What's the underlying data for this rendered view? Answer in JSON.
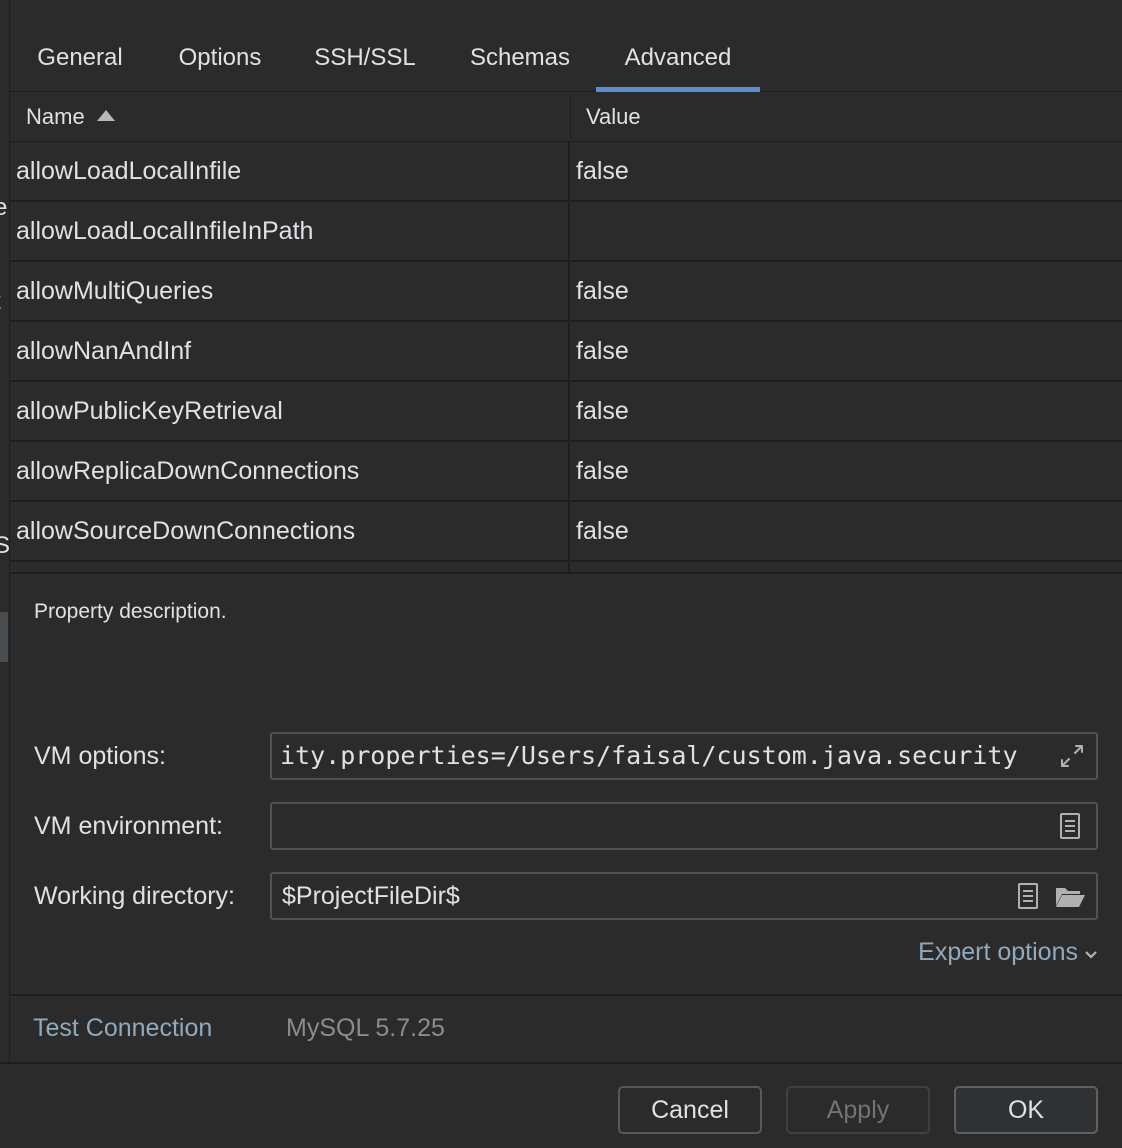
{
  "tabs": [
    {
      "label": "General"
    },
    {
      "label": "Options"
    },
    {
      "label": "SSH/SSL"
    },
    {
      "label": "Schemas"
    },
    {
      "label": "Advanced",
      "active": true
    }
  ],
  "table": {
    "headers": {
      "name": "Name",
      "value": "Value"
    },
    "rows": [
      {
        "name": "allowLoadLocalInfile",
        "value": "false"
      },
      {
        "name": "allowLoadLocalInfileInPath",
        "value": ""
      },
      {
        "name": "allowMultiQueries",
        "value": "false"
      },
      {
        "name": "allowNanAndInf",
        "value": "false"
      },
      {
        "name": "allowPublicKeyRetrieval",
        "value": "false"
      },
      {
        "name": "allowReplicaDownConnections",
        "value": "false"
      },
      {
        "name": "allowSourceDownConnections",
        "value": "false"
      }
    ]
  },
  "left_fragments": [
    "e",
    "t",
    "S"
  ],
  "description": "Property description.",
  "form": {
    "vm_options_label": "VM options:",
    "vm_options_value": "ity.properties=/Users/faisal/custom.java.security",
    "vm_environment_label": "VM environment:",
    "vm_environment_value": "",
    "working_directory_label": "Working directory:",
    "working_directory_value": "$ProjectFileDir$"
  },
  "expert_options": "Expert options",
  "test_connection": "Test Connection",
  "version": "MySQL 5.7.25",
  "buttons": {
    "cancel": "Cancel",
    "apply": "Apply",
    "ok": "OK"
  },
  "colors": {
    "accent": "#5b8ed3",
    "link": "#8fa9bd",
    "background": "#2b2b2b"
  },
  "icons": [
    "sort-ascending-icon",
    "expand-icon",
    "document-icon",
    "folder-open-icon",
    "chevron-down-icon"
  ]
}
